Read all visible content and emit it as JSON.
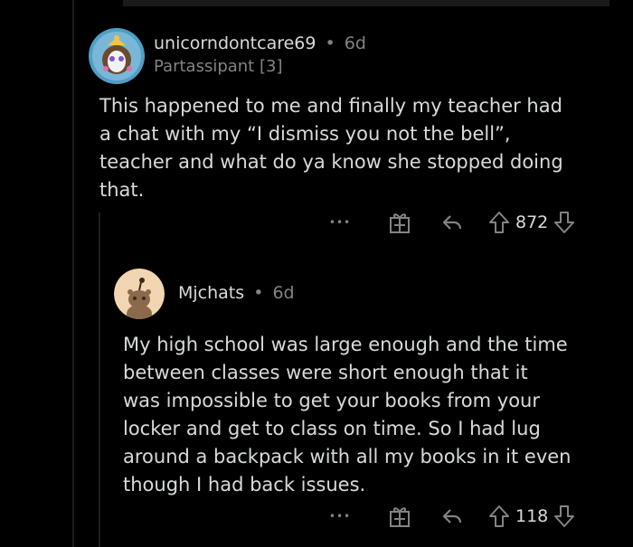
{
  "comments": [
    {
      "username": "unicorndontcare69",
      "separator": "•",
      "age": "6d",
      "flair": "Partassipant [3]",
      "text_lines": [
        "This happened to me and finally my teacher had",
        "a chat with my “I dismiss you not the bell”,",
        "teacher and what do ya know she stopped doing",
        "that."
      ],
      "more_label": "•••",
      "votes": "872"
    },
    {
      "username": "Mjchats",
      "separator": "•",
      "age": "6d",
      "text_lines": [
        "My high school was large enough and the time",
        "between classes were short enough that it",
        "was impossible to get your books from your",
        "locker and get to class on time. So I had lug",
        "around a backpack with all my books in it even",
        "though I had back issues."
      ],
      "more_label": "•••",
      "votes": "118"
    }
  ],
  "colors": {
    "background": "#000000",
    "text": "#d7dadc",
    "meta": "#818384",
    "thread_line": "#1f1f20"
  },
  "icons": [
    "more-icon",
    "award-icon",
    "reply-icon",
    "upvote-icon",
    "downvote-icon",
    "user-avatar"
  ]
}
